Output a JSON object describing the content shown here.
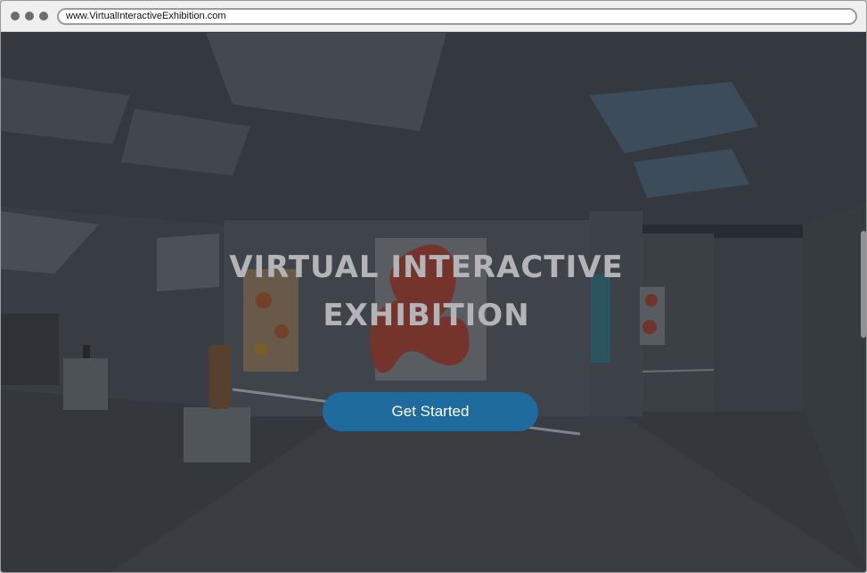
{
  "browser": {
    "url": "www.VirtualInteractiveExhibition.com"
  },
  "hero": {
    "title": "VIRTUAL INTERACTIVE EXHIBITION",
    "cta_label": "Get Started"
  },
  "colors": {
    "cta_background": "#1f6b9e",
    "title_text": "#b4b4b8",
    "scene_tint": "#2c3036"
  }
}
